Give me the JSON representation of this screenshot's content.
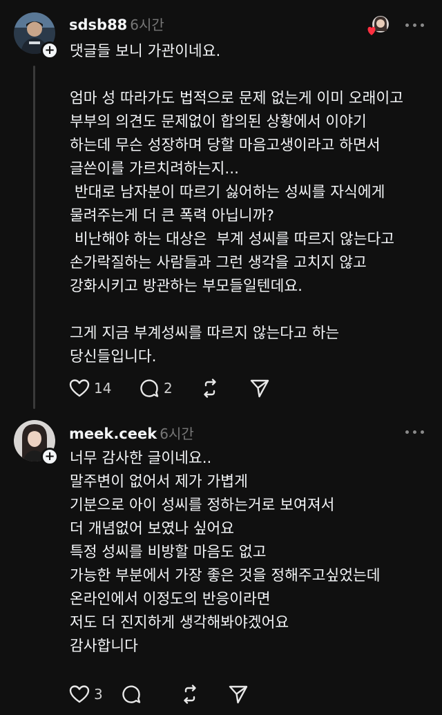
{
  "posts": [
    {
      "username": "sdsb88",
      "time": "6시간",
      "body": "댓글들 보니 가관이네요.\n\n엄마 성 따라가도 법적으로 문제 없는게 이미 오래이고\n부부의 의견도 문제없이 합의된 상황에서 이야기\n하는데 무슨 성장하며 당할 마음고생이라고 하면서\n글쓴이를 가르치려하는지...\n 반대로 남자분이 따르기 싫어하는 성씨를 자식에게\n물려주는게 더 큰 폭력 아닙니까?\n 비난해야 하는 대상은  부계 성씨를 따르지 않는다고\n손가락질하는 사람들과 그런 생각을 고치지 않고\n강화시키고 방관하는 부모들일텐데요.\n\n그게 지금 부계성씨를 따르지 않는다고 하는\n당신들입니다.",
      "likes": "14",
      "replies": "2",
      "follow_glyph": "+"
    },
    {
      "username": "meek.ceek",
      "time": "6시간",
      "body": "너무 감사한 글이네요..\n말주변이 없어서 제가 가볍게\n기분으로 아이 성씨를 정하는거로 보여져서\n더 개념없어 보였나 싶어요\n특정 성씨를 비방할 마음도 없고\n가능한 부분에서 가장 좋은 것을 정해주고싶었는데\n온라인에서 이정도의 반응이라면\n저도 더 진지하게 생각해봐야겠어요\n감사합니다",
      "likes": "3",
      "replies": "",
      "follow_glyph": "+"
    }
  ],
  "icons": {
    "like": "heart-icon",
    "reply": "comment-icon",
    "repost": "repost-icon",
    "share": "send-icon",
    "more": "more-dots-icon"
  },
  "colors": {
    "background": "#101010",
    "text": "#f3f5f7",
    "muted": "#777777",
    "liked_heart": "#ff3040"
  }
}
